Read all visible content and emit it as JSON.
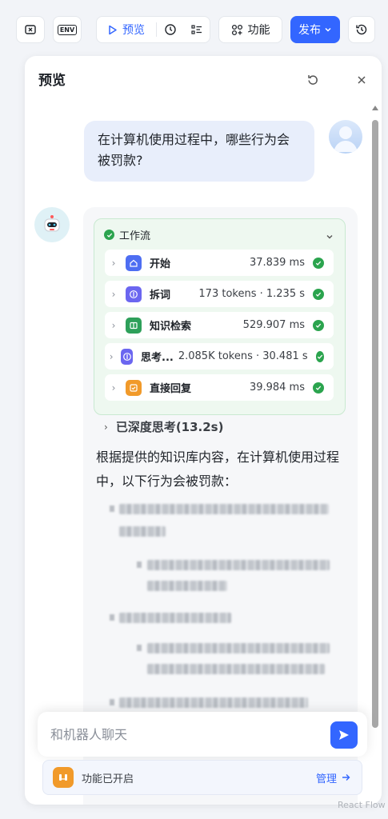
{
  "toolbar": {
    "preview_label": "预览",
    "features_label": "功能",
    "publish_label": "发布",
    "env_label": "ENV"
  },
  "panel": {
    "title": "预览"
  },
  "user_message": "在计算机使用过程中，哪些行为会被罚款?",
  "workflow": {
    "title": "工作流",
    "nodes": [
      {
        "name": "开始",
        "meta": "37.839 ms",
        "icon": "home-icon",
        "color": "#4e6ef2"
      },
      {
        "name": "拆词",
        "meta": "173 tokens · 1.235 s",
        "icon": "llm-icon",
        "color": "#6b66f0"
      },
      {
        "name": "知识检索",
        "meta": "529.907 ms",
        "icon": "book-icon",
        "color": "#2ea05a"
      },
      {
        "name": "思考...",
        "meta": "2.085K tokens · 30.481 s",
        "icon": "llm-icon",
        "color": "#6b66f0"
      },
      {
        "name": "直接回复",
        "meta": "39.984 ms",
        "icon": "reply-icon",
        "color": "#f19a2a"
      }
    ]
  },
  "thinking_label": "已深度思考(13.2s)",
  "answer_text": "根据提供的知识库内容，在计算机使用过程中，以下行为会被罚款：",
  "input": {
    "placeholder": "和机器人聊天"
  },
  "feature_bar": {
    "label": "功能已开启",
    "manage_label": "管理"
  },
  "watermark": "React Flow"
}
